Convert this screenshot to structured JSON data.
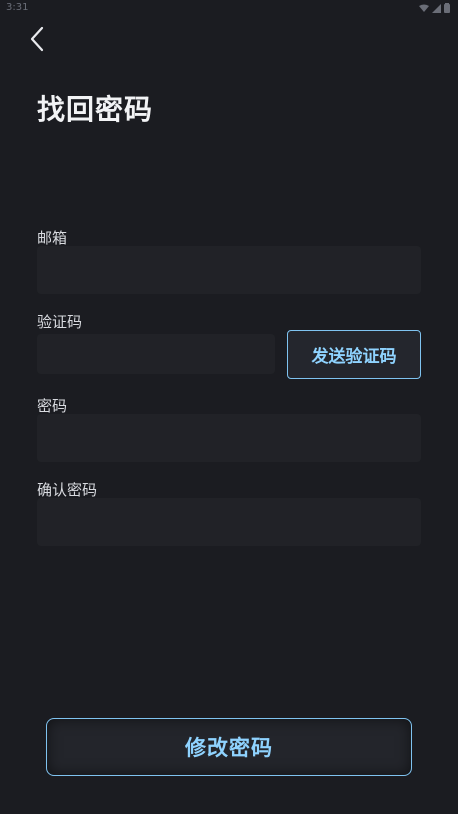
{
  "status_bar": {
    "time": "3:31",
    "icons": [
      "wifi-icon",
      "signal-icon",
      "battery-icon"
    ]
  },
  "header": {
    "back_icon": "chevron-left-icon",
    "title": "找回密码"
  },
  "form": {
    "email_label": "邮箱",
    "email_value": "",
    "code_label": "验证码",
    "code_value": "",
    "send_code_label": "发送验证码",
    "password_label": "密码",
    "password_value": "",
    "confirm_label": "确认密码",
    "confirm_value": ""
  },
  "actions": {
    "submit_label": "修改密码"
  },
  "colors": {
    "background": "#1b1c21",
    "input_bg": "#212227",
    "accent": "#8fd3ff",
    "accent_border": "#7fc3f0"
  }
}
